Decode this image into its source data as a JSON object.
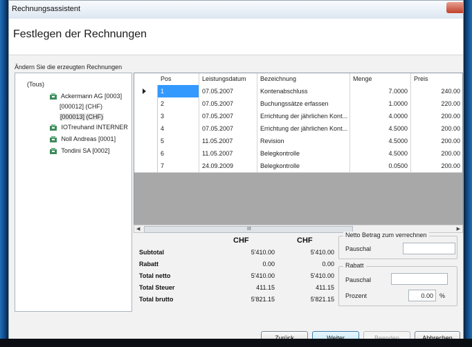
{
  "window": {
    "title": "Rechnungsassistent"
  },
  "page_title": "Festlegen der Rechnungen",
  "section_label": "Ändern Sie die erzeugten Rechnungen",
  "tree": {
    "root": "(Tous)",
    "items": [
      {
        "label": "Ackermann AG [0003]",
        "icon": "client-icon"
      },
      {
        "label": "[000012] (CHF)",
        "icon": ""
      },
      {
        "label": "[000013] (CHF)",
        "icon": ""
      },
      {
        "label": "IOTreuhand INTERNER",
        "icon": "client-icon"
      },
      {
        "label": "Noll Andreas [0001]",
        "icon": "client-icon"
      },
      {
        "label": "Tondini SA [0002]",
        "icon": "client-icon"
      }
    ]
  },
  "grid": {
    "columns": [
      "Pos",
      "Leistungsdatum",
      "Bezeichnung",
      "Menge",
      "Preis"
    ],
    "rows": [
      {
        "pos": "1",
        "datum": "07.05.2007",
        "bez": "Kontenabschluss",
        "menge": "7.0000",
        "preis": "240.00"
      },
      {
        "pos": "2",
        "datum": "07.05.2007",
        "bez": "Buchungssätze erfassen",
        "menge": "1.0000",
        "preis": "220.00"
      },
      {
        "pos": "3",
        "datum": "07.05.2007",
        "bez": "Errichtung der jährlichen Kont...",
        "menge": "4.0000",
        "preis": "200.00"
      },
      {
        "pos": "4",
        "datum": "07.05.2007",
        "bez": "Errichtung der jährlichen Kont...",
        "menge": "4.5000",
        "preis": "200.00"
      },
      {
        "pos": "5",
        "datum": "11.05.2007",
        "bez": "Revision",
        "menge": "4.5000",
        "preis": "200.00"
      },
      {
        "pos": "6",
        "datum": "11.05.2007",
        "bez": "Belegkontrolle",
        "menge": "4.5000",
        "preis": "200.00"
      },
      {
        "pos": "7",
        "datum": "24.09.2009",
        "bez": "Belegkontrolle",
        "menge": "0.0500",
        "preis": "200.00"
      }
    ],
    "scroll_grip": "III"
  },
  "totals": {
    "currency1": "CHF",
    "currency2": "CHF",
    "rows": [
      {
        "label": "Subtotal",
        "v1": "5'410.00",
        "v2": "5'410.00"
      },
      {
        "label": "Rabatt",
        "v1": "0.00",
        "v2": "0.00"
      },
      {
        "label": "Total netto",
        "v1": "5'410.00",
        "v2": "5'410.00"
      },
      {
        "label": "Total Steuer",
        "v1": "411.15",
        "v2": "411.15"
      },
      {
        "label": "Total brutto",
        "v1": "5'821.15",
        "v2": "5'821.15"
      }
    ]
  },
  "netto_box": {
    "title": "Netto Betrag zum verrechnen",
    "pauschal_label": "Pauschal",
    "pauschal_value": ""
  },
  "rabatt_box": {
    "title": "Rabatt",
    "pauschal_label": "Pauschal",
    "pauschal_value": "",
    "prozent_label": "Prozent",
    "prozent_value": "0.00",
    "prozent_unit": "%"
  },
  "buttons": {
    "back": "Zurück",
    "next": "Weiter",
    "finish": "Beenden",
    "cancel": "Abbrechen"
  }
}
